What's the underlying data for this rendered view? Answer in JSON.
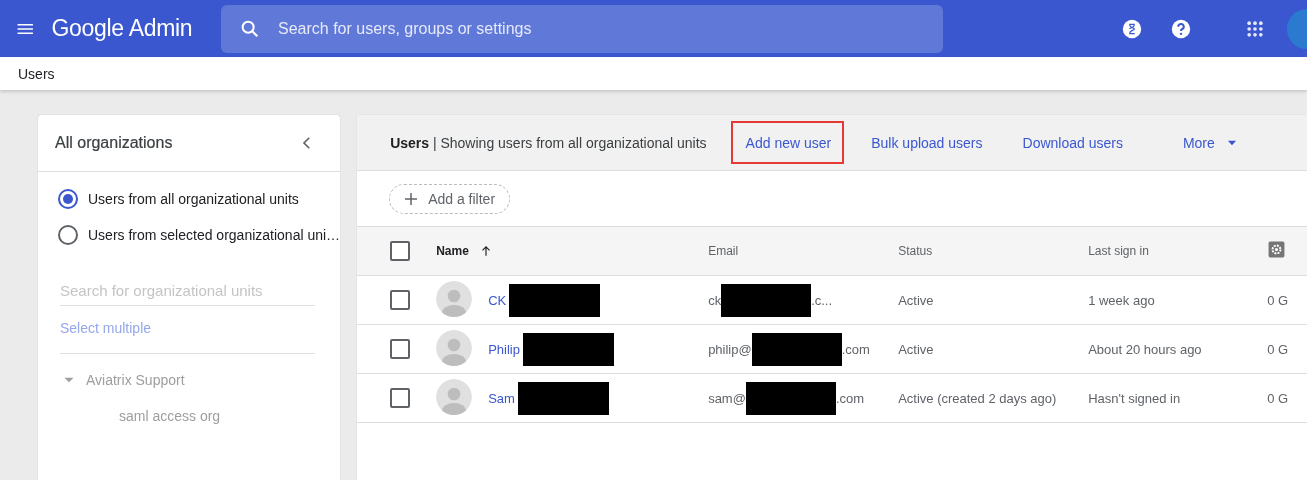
{
  "topbar": {
    "brand": "Google Admin",
    "search": {
      "placeholder": "Search for users, groups or settings"
    }
  },
  "breadcrumb": "Users",
  "sidebar": {
    "title": "All organizations",
    "options": [
      {
        "label": "Users from all organizational units",
        "selected": true
      },
      {
        "label": "Users from selected organizational uni…",
        "selected": false
      }
    ],
    "search": {
      "placeholder": "Search for organizational units"
    },
    "select_multiple": "Select multiple",
    "tree": [
      {
        "label": "Aviatrix Support",
        "expanded": true,
        "children": [
          {
            "label": "saml access org"
          }
        ]
      }
    ]
  },
  "users_panel": {
    "title": "Users",
    "subtitle": "| Showing users from all organizational units",
    "actions": [
      {
        "label": "Add new user",
        "highlighted": true
      },
      {
        "label": "Bulk upload users",
        "highlighted": false
      },
      {
        "label": "Download users",
        "highlighted": false
      },
      {
        "label": "More",
        "highlighted": false,
        "kind": "menu"
      }
    ],
    "add_filter": "Add a filter",
    "select_all_checked": false,
    "columns": [
      {
        "label": "Name",
        "sorted": true
      },
      {
        "label": "Email",
        "sorted": false
      },
      {
        "label": "Status",
        "sorted": false
      },
      {
        "label": "Last sign in",
        "sorted": false
      }
    ],
    "rows": [
      {
        "checked": false,
        "name": "CK",
        "name_redacted": true,
        "email_start": "ck",
        "email_end": ".c...",
        "email_redacted": true,
        "status": "Active",
        "last_sign_in": "1 week ago",
        "storage": "0 G"
      },
      {
        "checked": false,
        "name": "Philip",
        "name_redacted": true,
        "email_start": "philip@",
        "email_end": ".com",
        "email_redacted": true,
        "status": "Active",
        "last_sign_in": "About 20 hours ago",
        "storage": "0 G"
      },
      {
        "checked": false,
        "name": "Sam",
        "name_redacted": true,
        "email_start": "sam@",
        "email_end": ".com",
        "email_redacted": true,
        "status": "Active (created 2 days ago)",
        "last_sign_in": "Hasn't signed in",
        "storage": "0 G"
      }
    ]
  }
}
